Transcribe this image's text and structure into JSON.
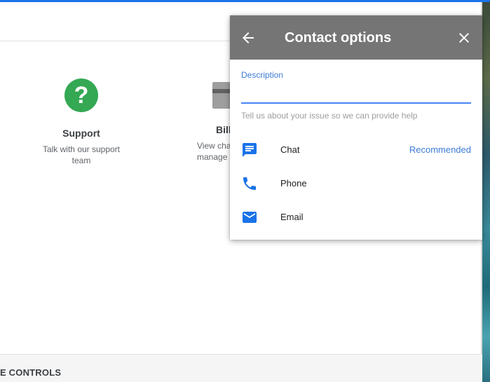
{
  "cards": {
    "support": {
      "title": "Support",
      "desc_line1": "Talk with our support",
      "desc_line2": "team",
      "icon": "help-circle-icon"
    },
    "billing": {
      "title": "Bill",
      "desc_line1": "View cha",
      "desc_line2": "manage",
      "icon": "credit-card-icon"
    }
  },
  "bottom": {
    "label": "E CONTROLS"
  },
  "popup": {
    "title": "Contact options",
    "description_label": "Description",
    "description_value": "",
    "helper": "Tell us about your issue so we can provide help",
    "options": [
      {
        "label": "Chat",
        "badge": "Recommended",
        "icon": "chat-icon"
      },
      {
        "label": "Phone",
        "icon": "phone-icon"
      },
      {
        "label": "Email",
        "icon": "email-icon"
      }
    ]
  },
  "colors": {
    "accent": "#1a73e8",
    "header_gray": "#757575",
    "link_blue": "#3d7bd6",
    "support_green": "#34a853",
    "icon_blue": "#1a73e8"
  }
}
